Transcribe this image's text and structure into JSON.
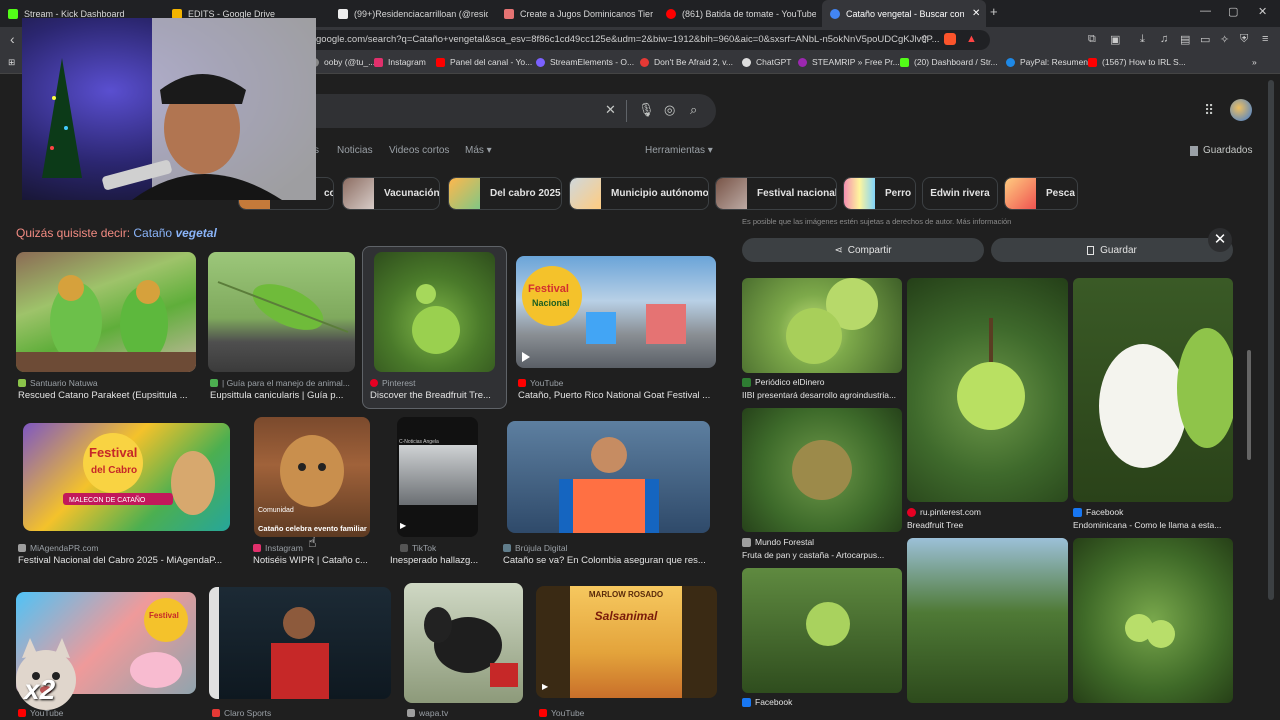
{
  "tabs": [
    {
      "title": "Stream - Kick Dashboard",
      "color": "#53fc18"
    },
    {
      "title": "EDITS - Google Drive",
      "color": "#f4b400"
    },
    {
      "title": "(99+)Residenciacarrilloan (@residenc",
      "color": "#eeeeee"
    },
    {
      "title": "Create a Jugos Dominicanos Tier List",
      "color": "#e57373"
    },
    {
      "title": "(861) Batida de tomate - YouTube",
      "color": "#ff0000"
    },
    {
      "title": "Cataño vengetal - Buscar con Google",
      "color": "#4285f4"
    }
  ],
  "address": {
    "url": "google.com/search?q=Cataño+vengetal&sca_esv=8f86c1cd49cc125e&udm=2&biw=1912&bih=960&aic=0&sxsrf=ANbL-n5okNnV5poUDCgKJlv0P..."
  },
  "bookmarks": [
    {
      "label": "ooby (@tu_...",
      "color": "#888888"
    },
    {
      "label": "Instagram",
      "color": "#e1306c"
    },
    {
      "label": "Panel del canal - Yo...",
      "color": "#ff0000"
    },
    {
      "label": "StreamElements - O...",
      "color": "#7b61ff"
    },
    {
      "label": "Don't Be Afraid 2, v...",
      "color": "#e53935"
    },
    {
      "label": "ChatGPT",
      "color": "#dddddd"
    },
    {
      "label": "STEAMRIP » Free Pr...",
      "color": "#9c27b0"
    },
    {
      "label": "(20) Dashboard / Str...",
      "color": "#53fc18"
    },
    {
      "label": "PayPal: Resumen",
      "color": "#1e88e5"
    },
    {
      "label": "(1567) How to IRL S...",
      "color": "#ff0000"
    }
  ],
  "nav": {
    "links": [
      "s",
      "Noticias",
      "Videos cortos",
      "Más ▾"
    ],
    "tools": "Herramientas ▾",
    "saved": "Guardados"
  },
  "chips": [
    {
      "label": "co",
      "color": "#c47a3a"
    },
    {
      "label": "Vacunación",
      "color": "#8d6e63"
    },
    {
      "label": "Del cabro 2025",
      "color": "#a5d6a7"
    },
    {
      "label": "Municipio autónomo",
      "color": "#cfd8dc"
    },
    {
      "label": "Festival nacional",
      "color": "#795548"
    },
    {
      "label": "Perro",
      "color": "#f48fb1"
    },
    {
      "label": "Edwin rivera",
      "color": ""
    },
    {
      "label": "Pesca",
      "color": "#ffcc80"
    }
  ],
  "didyoumean": {
    "prefix": "Quizás quisiste decir:",
    "word1": "Cataño",
    "word2": "vegetal"
  },
  "results": [
    {
      "source": "Santuario Natuwa",
      "title": "Rescued Catano Parakeet (Eupsittula ...",
      "srccolor": "#8bc34a"
    },
    {
      "source": "| Guía para el manejo de animal...",
      "title": "Eupsittula canicularis | Guía p...",
      "srccolor": "#4caf50"
    },
    {
      "source": "Pinterest",
      "title": "Discover the Breadfruit Tre...",
      "srccolor": "#e60023"
    },
    {
      "source": "YouTube",
      "title": "Cataño, Puerto Rico National Goat Festival ...",
      "srccolor": "#ff0000"
    },
    {
      "source": "MiAgendaPR.com",
      "title": "Festival Nacional del Cabro 2025 - MiAgendaP...",
      "srccolor": "#9e9e9e"
    },
    {
      "source": "Instagram",
      "title": "Notiséis WIPR | Cataño c...",
      "srccolor": "#e1306c"
    },
    {
      "source": "TikTok",
      "title": "Inesperado hallazg...",
      "srccolor": "#333333"
    },
    {
      "source": "Brújula Digital",
      "title": "Cataño se va? En Colombia aseguran que res...",
      "srccolor": "#607d8b"
    },
    {
      "source": "YouTube",
      "title": "",
      "srccolor": "#ff0000"
    },
    {
      "source": "Claro Sports",
      "title": "",
      "srccolor": "#e53935"
    },
    {
      "source": "wapa.tv",
      "title": "",
      "srccolor": "#9e9e9e"
    },
    {
      "source": "YouTube",
      "title": "",
      "srccolor": "#ff0000"
    }
  ],
  "result_overlays": {
    "community": "Comunidad",
    "event": "Cataño celebra evento familiar",
    "tiktok_caption": "C-Noticias Angela",
    "poster_title": "MARLOW ROSADO",
    "poster_sub": "Salsanimal",
    "festival_word1": "Festival",
    "festival_word2": "Nacional",
    "festival_word3": "del Cabro",
    "malecon": "MALECON DE CATAÑO",
    "badge": "x2"
  },
  "panel": {
    "disclaimer": "Es posible que las imágenes estén sujetas a derechos de autor. Más información",
    "share": "Compartir",
    "save": "Guardar",
    "close": "✕",
    "items": [
      {
        "source": "Periódico elDinero",
        "title": "IIBI presentará desarrollo agroindustria...",
        "srccolor": "#2e7d32"
      },
      {
        "source": "ru.pinterest.com",
        "title": "Breadfruit Tree",
        "srccolor": "#e60023"
      },
      {
        "source": "Facebook",
        "title": "Endominicana - Como le llama a esta...",
        "srccolor": "#1877f2"
      },
      {
        "source": "Mundo Forestal",
        "title": "Fruta de pan y castaña - Artocarpus...",
        "srccolor": "#9e9e9e"
      },
      {
        "source": "Facebook",
        "title": "",
        "srccolor": "#1877f2"
      }
    ]
  }
}
